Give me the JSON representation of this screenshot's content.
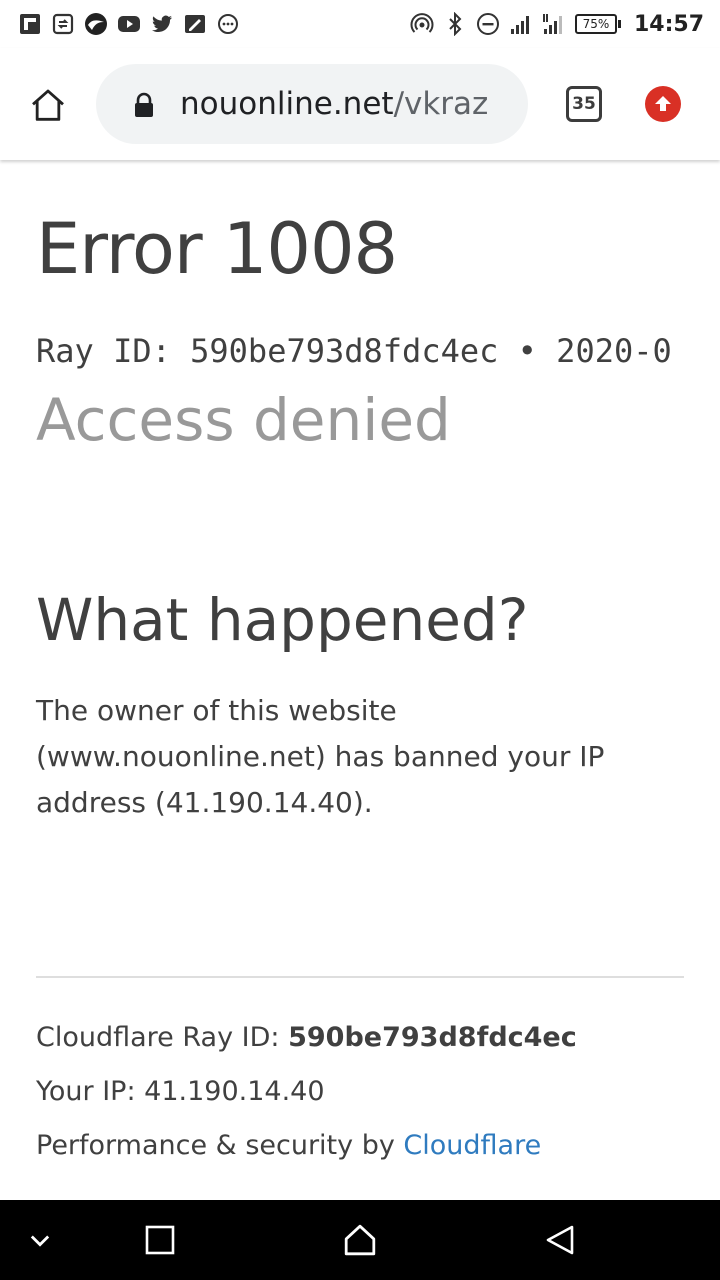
{
  "status_bar": {
    "left_icons": [
      "flipboard-icon",
      "sync-app-icon",
      "wave-app-icon",
      "youtube-icon",
      "twitter-icon",
      "notes-app-icon",
      "chat-bubble-icon"
    ],
    "right_icons": [
      "hotspot-icon",
      "bluetooth-icon",
      "do-not-disturb-icon",
      "signal-icon",
      "signal-2-icon"
    ],
    "battery": "75%",
    "time": "14:57"
  },
  "toolbar": {
    "url_host": "nouonline.net",
    "url_path": "/vkraz",
    "tab_count": "35"
  },
  "page": {
    "title": "Error 1008",
    "ray_line": "Ray ID: 590be793d8fdc4ec • 2020-0",
    "subtitle": "Access denied",
    "section_heading": "What happened?",
    "explanation": "The owner of this website (www.nouonline.net) has banned your IP address (41.190.14.40).",
    "footer": {
      "ray_label": "Cloudflare Ray ID: ",
      "ray_value": "590be793d8fdc4ec",
      "ip_label": "Your IP: ",
      "ip_value": "41.190.14.40",
      "perf_label": "Performance & security by ",
      "perf_link": "Cloudflare"
    }
  },
  "colors": {
    "text": "#404040",
    "muted": "#999999",
    "link": "#2f7bbf",
    "update_badge": "#d93025",
    "urlbar_bg": "#f1f3f4"
  }
}
